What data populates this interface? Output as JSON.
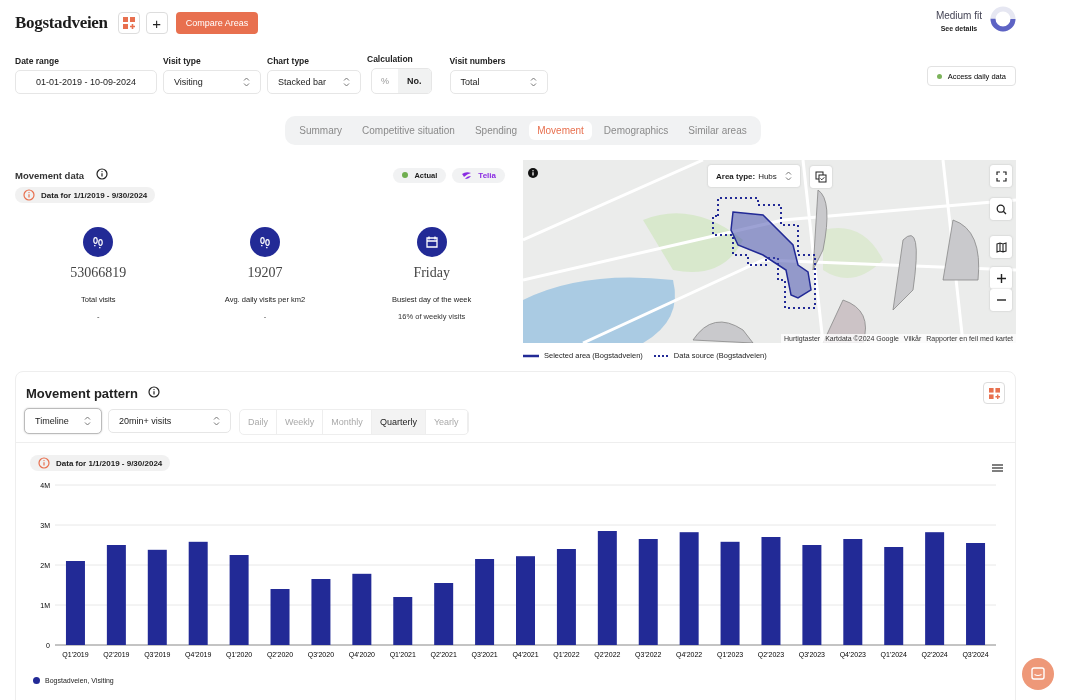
{
  "header": {
    "title": "Bogstadveien",
    "add_button": "+",
    "compare_button": "Compare Areas",
    "fit": {
      "label": "Medium fit",
      "link": "See details"
    }
  },
  "filters": [
    {
      "kind": "text",
      "label": "Date range",
      "value": "01-01-2019 - 10-09-2024"
    },
    {
      "kind": "select",
      "label": "Visit type",
      "value": "Visiting"
    },
    {
      "kind": "select",
      "label": "Chart type",
      "value": "Stacked bar"
    },
    {
      "kind": "toggle",
      "label": "Calculation",
      "options": [
        {
          "label": "%",
          "selected": false
        },
        {
          "label": "No.",
          "selected": true
        }
      ]
    },
    {
      "kind": "select",
      "label": "Visit numbers",
      "value": "Total"
    }
  ],
  "access_button": {
    "label": "Access daily data",
    "color": "#7cb35b"
  },
  "tabs": [
    {
      "label": "Summary",
      "selected": false
    },
    {
      "label": "Competitive situation",
      "selected": false
    },
    {
      "label": "Spending",
      "selected": false
    },
    {
      "label": "Movement",
      "selected": true
    },
    {
      "label": "Demographics",
      "selected": false
    },
    {
      "label": "Similar areas",
      "selected": false
    }
  ],
  "movement_data": {
    "title": "Movement data",
    "date_badge": "Data for 1/1/2019 - 9/30/2024",
    "status": {
      "label": "Actual",
      "color": "#6fae4f"
    },
    "provider": "Telia",
    "stats": [
      {
        "kind": "footprints",
        "value": "53066819",
        "label": "Total visits",
        "note": "-"
      },
      {
        "kind": "footprints",
        "value": "19207",
        "label": "Avg. daily visits per km2",
        "note": "-"
      },
      {
        "kind": "calendar",
        "value": "Friday",
        "label": "Busiest day of the week",
        "note": "16% of weekly visits"
      }
    ]
  },
  "map": {
    "area_type": {
      "label": "Area type:",
      "value": "Hubs"
    },
    "attribution": [
      "Hurtigtaster",
      "Kartdata ©2024 Google",
      "Vilkår",
      "Rapporter en feil med kartet"
    ],
    "legend": [
      {
        "kind": "solid",
        "label": "Selected area (Bogstadveien)"
      },
      {
        "kind": "dotted",
        "label": "Data source (Bogstadveien)"
      }
    ]
  },
  "pattern": {
    "title": "Movement pattern",
    "view_select": "Timeline",
    "visits_select": "20min+ visits",
    "periods": [
      {
        "label": "Daily",
        "selected": false
      },
      {
        "label": "Weekly",
        "selected": false
      },
      {
        "label": "Monthly",
        "selected": false
      },
      {
        "label": "Quarterly",
        "selected": true
      },
      {
        "label": "Yearly",
        "selected": false
      }
    ],
    "date_badge": "Data for 1/1/2019 - 9/30/2024",
    "chart_data": {
      "type": "bar",
      "categories": [
        "Q1'2019",
        "Q2'2019",
        "Q3'2019",
        "Q4'2019",
        "Q1'2020",
        "Q2'2020",
        "Q3'2020",
        "Q4'2020",
        "Q1'2021",
        "Q2'2021",
        "Q3'2021",
        "Q4'2021",
        "Q1'2022",
        "Q2'2022",
        "Q3'2022",
        "Q4'2022",
        "Q1'2023",
        "Q2'2023",
        "Q3'2023",
        "Q4'2023",
        "Q1'2024",
        "Q2'2024",
        "Q3'2024"
      ],
      "series": [
        {
          "name": "Bogstadveien, Visiting",
          "color": "#222a96",
          "values": [
            2100000,
            2500000,
            2380000,
            2580000,
            2250000,
            1400000,
            1650000,
            1780000,
            1200000,
            1550000,
            2150000,
            2220000,
            2400000,
            2850000,
            2650000,
            2820000,
            2580000,
            2700000,
            2500000,
            2650000,
            2450000,
            2820000,
            2550000
          ]
        }
      ],
      "ylim": [
        0,
        4000000
      ],
      "grid": true,
      "yticks": [
        {
          "value": 0,
          "label": "0"
        },
        {
          "value": 1000000,
          "label": "1M"
        },
        {
          "value": 2000000,
          "label": "2M"
        },
        {
          "value": 3000000,
          "label": "3M"
        },
        {
          "value": 4000000,
          "label": "4M"
        }
      ]
    }
  }
}
